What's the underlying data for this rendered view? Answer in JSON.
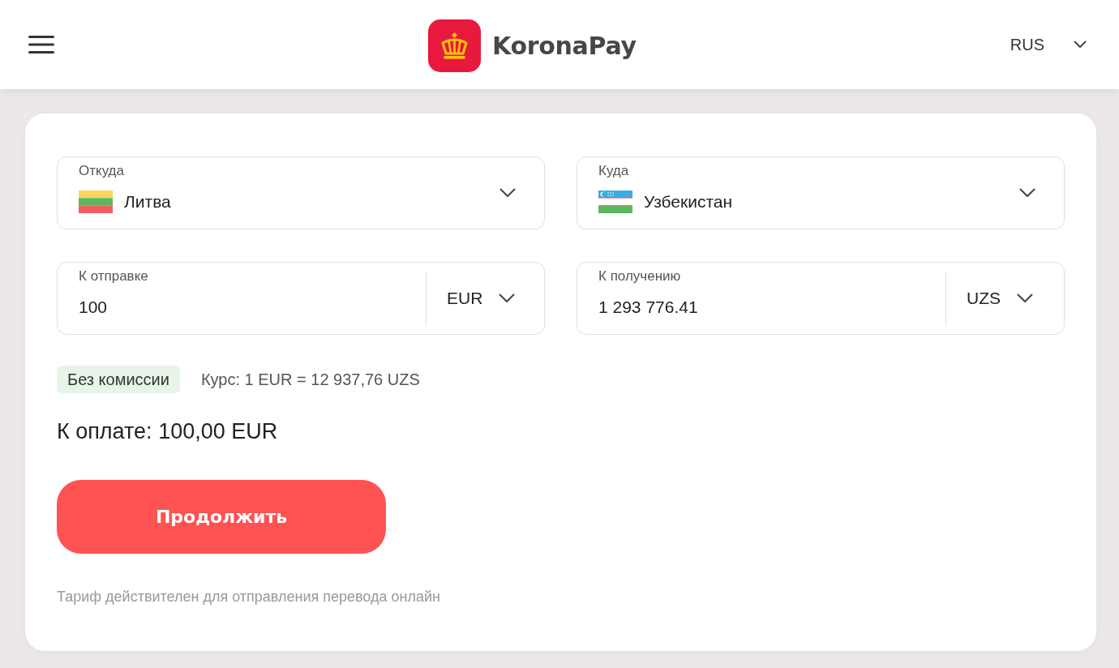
{
  "header": {
    "logo_text": "KoronaPay",
    "language": "RUS"
  },
  "direction_fields": [
    {
      "label": "Откуда",
      "value": "Литва",
      "kind": "lt"
    },
    {
      "label": "Куда",
      "value": "Узбекистан",
      "kind": "uz"
    }
  ],
  "amount_fields": [
    {
      "label": "К отправке",
      "value": "100",
      "currency": "EUR"
    },
    {
      "label": "К получению",
      "value": "1 293 776.41",
      "currency": "UZS"
    }
  ],
  "fee_tag": "Без комиссии",
  "rate": "Курс: 1 EUR = 12 937,76 UZS",
  "total": "К оплате: 100,00 EUR",
  "continue_button": "Продолжить",
  "note": "Тариф действителен для отправления перевода онлайн"
}
